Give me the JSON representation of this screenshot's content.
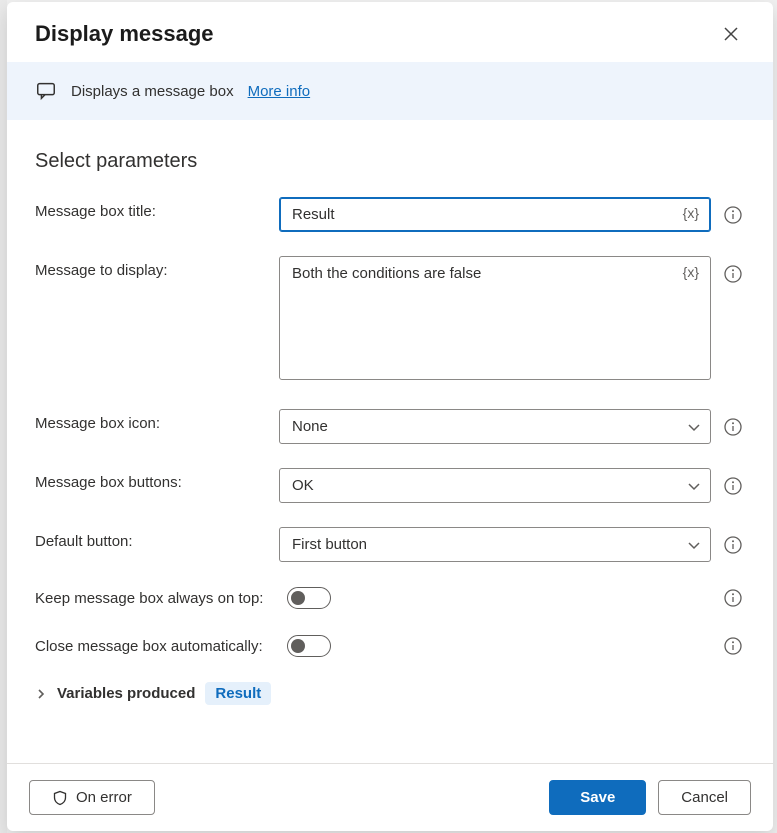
{
  "header": {
    "title": "Display message"
  },
  "banner": {
    "text": "Displays a message box",
    "more_info": "More info"
  },
  "section_title": "Select parameters",
  "fields": {
    "title_label": "Message box title:",
    "title_value": "Result",
    "message_label": "Message to display:",
    "message_value": "Both the conditions are false",
    "icon_label": "Message box icon:",
    "icon_value": "None",
    "buttons_label": "Message box buttons:",
    "buttons_value": "OK",
    "default_btn_label": "Default button:",
    "default_btn_value": "First button",
    "always_on_top_label": "Keep message box always on top:",
    "auto_close_label": "Close message box automatically:",
    "var_token": "{x}"
  },
  "vars_produced": {
    "label": "Variables produced",
    "value": "Result"
  },
  "footer": {
    "on_error": "On error",
    "save": "Save",
    "cancel": "Cancel"
  }
}
